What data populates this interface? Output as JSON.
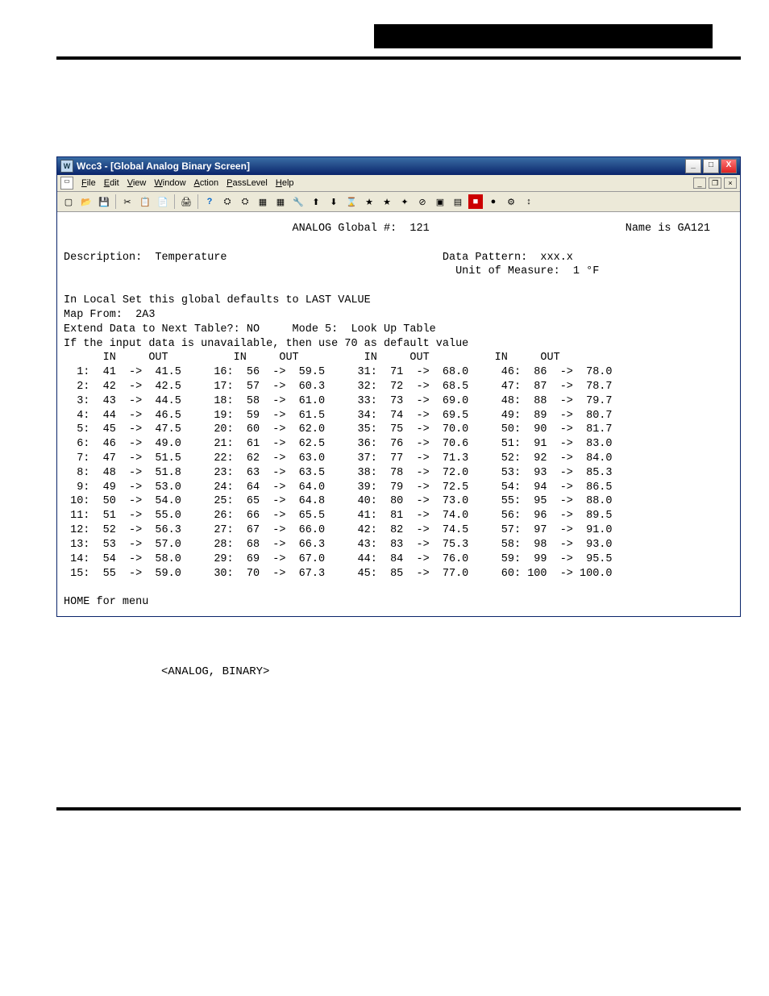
{
  "window": {
    "title": "Wcc3 - [Global Analog Binary Screen]",
    "min_label": "_",
    "max_label": "□",
    "close_label": "X"
  },
  "menu": {
    "items": [
      "File",
      "Edit",
      "View",
      "Window",
      "Action",
      "PassLevel",
      "Help"
    ]
  },
  "header": {
    "analog_global_label": "ANALOG Global #:",
    "analog_global_num": "121",
    "name_label": "Name is",
    "name_value": "GA121",
    "description_label": "Description:",
    "description_value": "Temperature",
    "data_pattern_label": "Data Pattern:",
    "data_pattern_value": "xxx.x",
    "unit_label": "Unit of Measure:",
    "unit_value": "1 °F",
    "local_set_line": "In Local Set this global defaults to LAST VALUE",
    "map_from_label": "Map From:",
    "map_from_value": "2A3",
    "extend_label": "Extend Data to Next Table?:",
    "extend_value": "NO",
    "mode_label": "Mode 5:",
    "mode_value": "Look Up Table",
    "default_line": "If the input data is unavailable, then use 70 as default value",
    "col_in": "IN",
    "col_out": "OUT",
    "footer": "HOME for menu"
  },
  "table": [
    {
      "n": 1,
      "in": 41,
      "out": "41.5"
    },
    {
      "n": 2,
      "in": 42,
      "out": "42.5"
    },
    {
      "n": 3,
      "in": 43,
      "out": "44.5"
    },
    {
      "n": 4,
      "in": 44,
      "out": "46.5"
    },
    {
      "n": 5,
      "in": 45,
      "out": "47.5"
    },
    {
      "n": 6,
      "in": 46,
      "out": "49.0"
    },
    {
      "n": 7,
      "in": 47,
      "out": "51.5"
    },
    {
      "n": 8,
      "in": 48,
      "out": "51.8"
    },
    {
      "n": 9,
      "in": 49,
      "out": "53.0"
    },
    {
      "n": 10,
      "in": 50,
      "out": "54.0"
    },
    {
      "n": 11,
      "in": 51,
      "out": "55.0"
    },
    {
      "n": 12,
      "in": 52,
      "out": "56.3"
    },
    {
      "n": 13,
      "in": 53,
      "out": "57.0"
    },
    {
      "n": 14,
      "in": 54,
      "out": "58.0"
    },
    {
      "n": 15,
      "in": 55,
      "out": "59.0"
    },
    {
      "n": 16,
      "in": 56,
      "out": "59.5"
    },
    {
      "n": 17,
      "in": 57,
      "out": "60.3"
    },
    {
      "n": 18,
      "in": 58,
      "out": "61.0"
    },
    {
      "n": 19,
      "in": 59,
      "out": "61.5"
    },
    {
      "n": 20,
      "in": 60,
      "out": "62.0"
    },
    {
      "n": 21,
      "in": 61,
      "out": "62.5"
    },
    {
      "n": 22,
      "in": 62,
      "out": "63.0"
    },
    {
      "n": 23,
      "in": 63,
      "out": "63.5"
    },
    {
      "n": 24,
      "in": 64,
      "out": "64.0"
    },
    {
      "n": 25,
      "in": 65,
      "out": "64.8"
    },
    {
      "n": 26,
      "in": 66,
      "out": "65.5"
    },
    {
      "n": 27,
      "in": 67,
      "out": "66.0"
    },
    {
      "n": 28,
      "in": 68,
      "out": "66.3"
    },
    {
      "n": 29,
      "in": 69,
      "out": "67.0"
    },
    {
      "n": 30,
      "in": 70,
      "out": "67.3"
    },
    {
      "n": 31,
      "in": 71,
      "out": "68.0"
    },
    {
      "n": 32,
      "in": 72,
      "out": "68.5"
    },
    {
      "n": 33,
      "in": 73,
      "out": "69.0"
    },
    {
      "n": 34,
      "in": 74,
      "out": "69.5"
    },
    {
      "n": 35,
      "in": 75,
      "out": "70.0"
    },
    {
      "n": 36,
      "in": 76,
      "out": "70.6"
    },
    {
      "n": 37,
      "in": 77,
      "out": "71.3"
    },
    {
      "n": 38,
      "in": 78,
      "out": "72.0"
    },
    {
      "n": 39,
      "in": 79,
      "out": "72.5"
    },
    {
      "n": 40,
      "in": 80,
      "out": "73.0"
    },
    {
      "n": 41,
      "in": 81,
      "out": "74.0"
    },
    {
      "n": 42,
      "in": 82,
      "out": "74.5"
    },
    {
      "n": 43,
      "in": 83,
      "out": "75.3"
    },
    {
      "n": 44,
      "in": 84,
      "out": "76.0"
    },
    {
      "n": 45,
      "in": 85,
      "out": "77.0"
    },
    {
      "n": 46,
      "in": 86,
      "out": "78.0"
    },
    {
      "n": 47,
      "in": 87,
      "out": "78.7"
    },
    {
      "n": 48,
      "in": 88,
      "out": "79.7"
    },
    {
      "n": 49,
      "in": 89,
      "out": "80.7"
    },
    {
      "n": 50,
      "in": 90,
      "out": "81.7"
    },
    {
      "n": 51,
      "in": 91,
      "out": "83.0"
    },
    {
      "n": 52,
      "in": 92,
      "out": "84.0"
    },
    {
      "n": 53,
      "in": 93,
      "out": "85.3"
    },
    {
      "n": 54,
      "in": 94,
      "out": "86.5"
    },
    {
      "n": 55,
      "in": 95,
      "out": "88.0"
    },
    {
      "n": 56,
      "in": 96,
      "out": "89.5"
    },
    {
      "n": 57,
      "in": 97,
      "out": "91.0"
    },
    {
      "n": 58,
      "in": 98,
      "out": "93.0"
    },
    {
      "n": 59,
      "in": 99,
      "out": "95.5"
    },
    {
      "n": 60,
      "in": 100,
      "out": "100.0"
    }
  ],
  "caption": "<ANALOG, BINARY>"
}
